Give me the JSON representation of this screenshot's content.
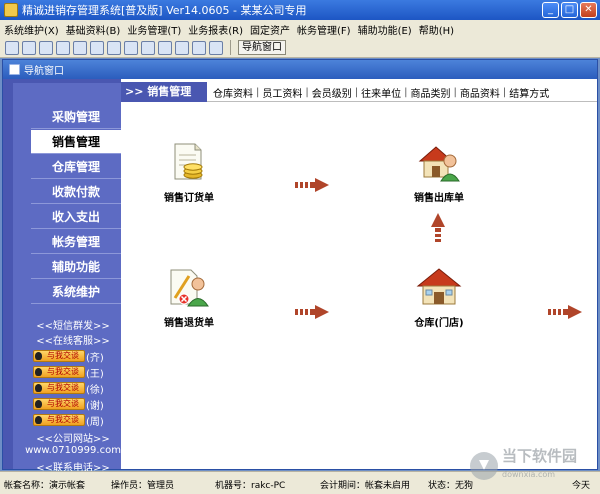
{
  "window": {
    "title": "精诚进销存管理系统[普及版] Ver14.0605 - 某某公司专用",
    "minimize": "_",
    "maximize": "□",
    "close": "✕"
  },
  "menubar": {
    "items": [
      "系统维护(X)",
      "基础资料(B)",
      "业务管理(T)",
      "业务报表(R)",
      "固定资产",
      "帐务管理(F)",
      "辅助功能(E)",
      "帮助(H)"
    ]
  },
  "toolbar": {
    "nav_window_label": "导航窗口",
    "icons": [
      "new-icon",
      "open-icon",
      "list-icon",
      "print-icon",
      "people-icon",
      "money-icon",
      "chart-icon",
      "config-icon",
      "window-icon",
      "save-icon",
      "report-icon",
      "help-icon",
      "exit-icon"
    ]
  },
  "inner_window": {
    "title": "导航窗口"
  },
  "sidebar": {
    "items": [
      {
        "label": "采购管理",
        "active": false
      },
      {
        "label": "销售管理",
        "active": true
      },
      {
        "label": "仓库管理",
        "active": false
      },
      {
        "label": "收款付款",
        "active": false
      },
      {
        "label": "收入支出",
        "active": false
      },
      {
        "label": "帐务管理",
        "active": false
      },
      {
        "label": "辅助功能",
        "active": false
      },
      {
        "label": "系统维护",
        "active": false
      }
    ],
    "sms_link": "<<短信群发>>",
    "service_link": "<<在线客服>>",
    "qq_button_label": "与我交谈",
    "qq_contacts": [
      "(齐)",
      "(王)",
      "(徐)",
      "(谢)",
      "(周)"
    ],
    "website_link": "<<公司网站>>",
    "website_url": "www.0710999.com",
    "contact_link": "<<联系电话>>"
  },
  "header": {
    "section_title": ">> 销售管理",
    "links": [
      "仓库资料",
      "员工资料",
      "会员级别",
      "往来单位",
      "商品类别",
      "商品资料",
      "结算方式"
    ],
    "separator": "|"
  },
  "workflow": {
    "sales_order": "销售订货单",
    "sales_outbound": "销售出库单",
    "sales_return": "销售退货单",
    "warehouse": "仓库(门店)"
  },
  "statusbar": {
    "account_set": "帐套名称：演示帐套",
    "operator": "操作员：管理员",
    "machine": "机器号：rakc-PC",
    "period": "会计期间：帐套未启用",
    "state": "状态：无狗",
    "today": "今天"
  },
  "watermark": {
    "text": "当下软件园",
    "sub": "downxia.com"
  },
  "colors": {
    "sidebar": "#4a57b1",
    "titlebar": "#2b5dbd",
    "arrow": "#b0452a"
  }
}
